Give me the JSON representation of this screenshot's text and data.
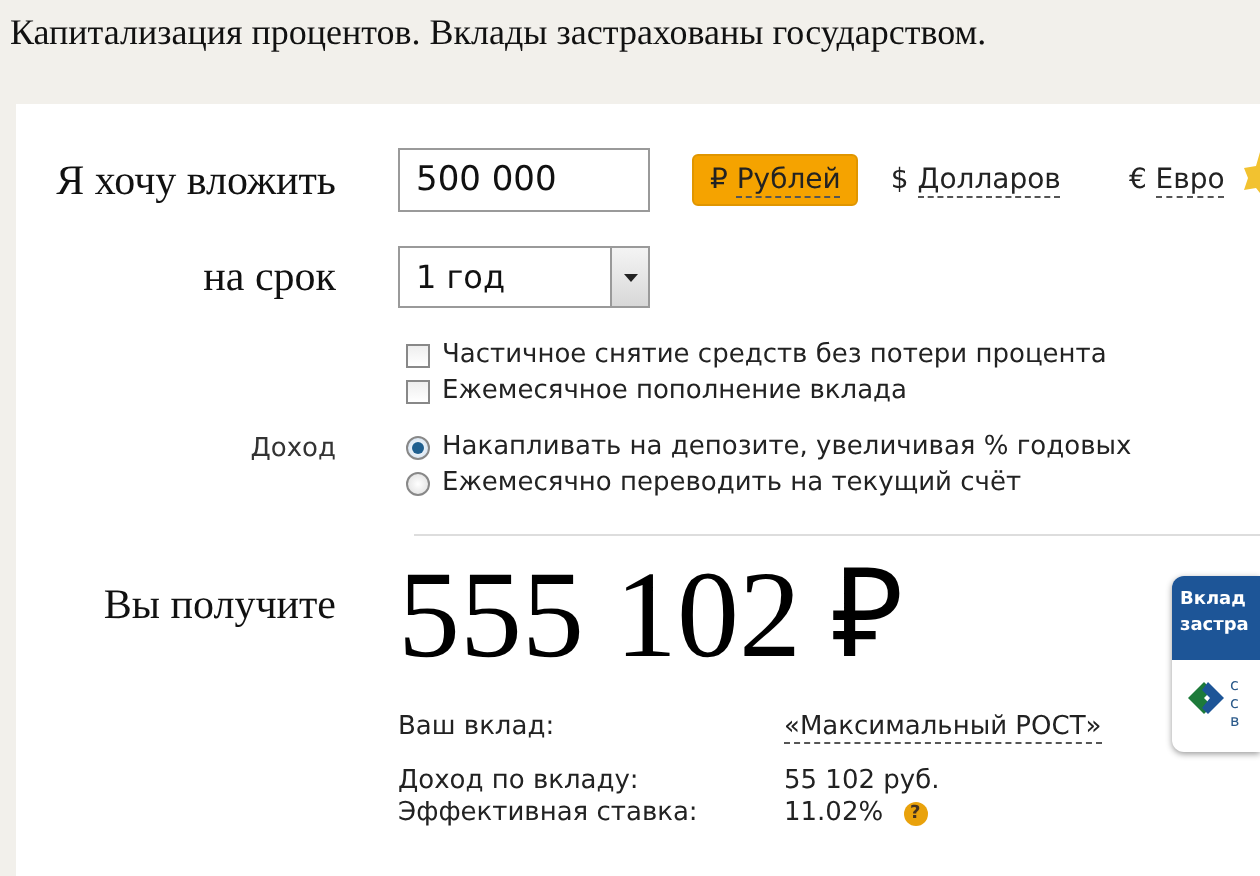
{
  "heading": "Капитализация процентов. Вклады застрахованы государством.",
  "invest": {
    "label": "Я хочу вложить",
    "value": "500 000"
  },
  "currencies": [
    {
      "symbol": "₽",
      "label": "Рублей",
      "selected": true
    },
    {
      "symbol": "$",
      "label": "Долларов",
      "selected": false
    },
    {
      "symbol": "€",
      "label": "Евро",
      "selected": false
    }
  ],
  "term": {
    "label": "на срок",
    "value": "1 год"
  },
  "options": [
    {
      "label": "Частичное снятие средств без потери процента",
      "checked": false
    },
    {
      "label": "Ежемесячное пополнение вклада",
      "checked": false
    }
  ],
  "income": {
    "label": "Доход",
    "choices": [
      {
        "label": "Накапливать на депозите, увеличивая % годовых",
        "selected": true
      },
      {
        "label": "Ежемесячно переводить на текущий счёт",
        "selected": false
      }
    ]
  },
  "result": {
    "label": "Вы получите",
    "amount": "555 102 ₽",
    "details": [
      {
        "label": "Ваш вклад:",
        "value": "«Максимальный РОСТ»",
        "kind": "link"
      },
      {
        "label": "Доход по вкладу:",
        "value": "55 102 руб.",
        "kind": "text"
      },
      {
        "label": "Эффективная ставка:",
        "value": "11.02%",
        "kind": "help",
        "help": "?"
      }
    ]
  },
  "badge": {
    "lines": [
      "Вклад",
      "застра"
    ],
    "side_letters": [
      "с",
      "с",
      "в"
    ]
  }
}
